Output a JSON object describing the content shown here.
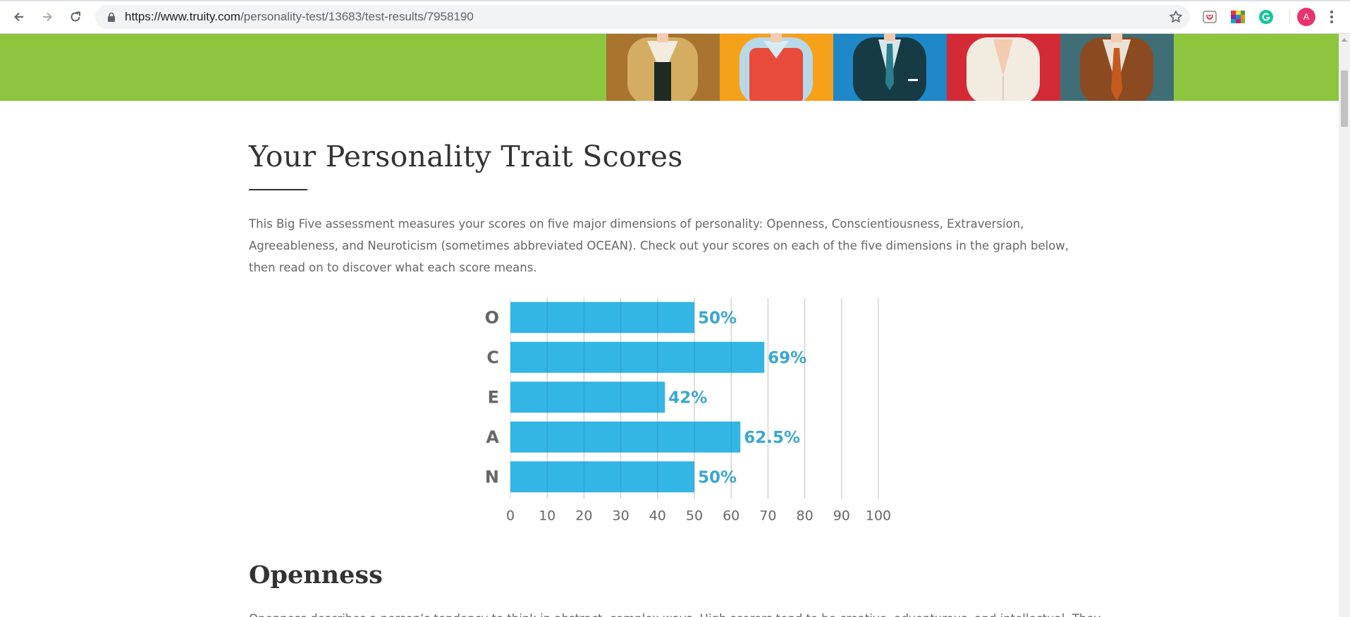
{
  "browser": {
    "url_host": "https://www.truity.com",
    "url_path": "/personality-test/13683/test-results/7958190",
    "avatar_letter": "A"
  },
  "colors": {
    "banner": "#8cc63f",
    "bar": "#33b5e5",
    "label": "#3aa6d1",
    "axis_text": "#666666"
  },
  "main": {
    "title": "Your Personality Trait Scores",
    "intro": "This Big Five assessment measures your scores on five major dimensions of personality: Openness, Conscientiousness, Extraversion, Agreeableness, and Neuroticism (sometimes abbreviated OCEAN). Check out your scores on each of the five dimensions in the graph below, then read on to discover what each score means.",
    "section_title": "Openness",
    "section_body": "Openness describes a person’s tendency to think in abstract, complex ways. High scorers tend to be creative, adventurous, and intellectual. They"
  },
  "chart_data": {
    "type": "bar",
    "orientation": "horizontal",
    "categories": [
      "O",
      "C",
      "E",
      "A",
      "N"
    ],
    "values": [
      50,
      69,
      42,
      62.5,
      50
    ],
    "value_labels": [
      "50%",
      "69%",
      "42%",
      "62.5%",
      "50%"
    ],
    "xlim": [
      0,
      100
    ],
    "xticks": [
      0,
      10,
      20,
      30,
      40,
      50,
      60,
      70,
      80,
      90,
      100
    ],
    "grid": true
  }
}
